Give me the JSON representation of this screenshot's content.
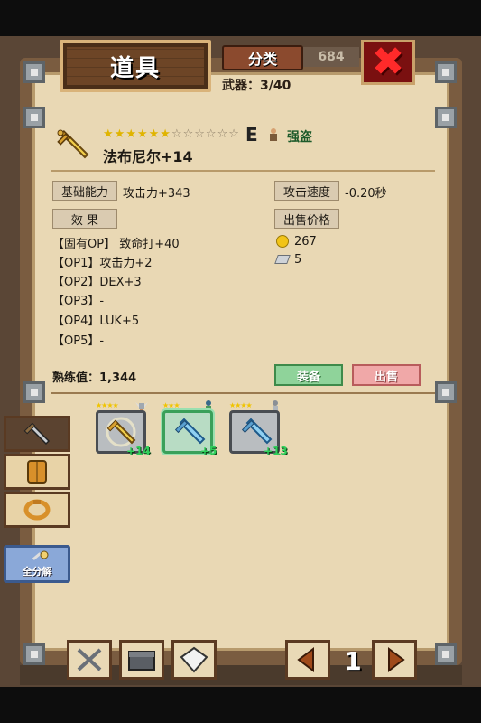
{
  "header": {
    "title": "道具",
    "category_label": "分类",
    "weapon_count": "武器：3/40",
    "close_icon": "close-x-icon",
    "obscured_counter": "684"
  },
  "item": {
    "icon": "golden-sword-icon",
    "stars_filled": 6,
    "stars_total": 12,
    "grade": "E",
    "class_icon": "thief-icon",
    "class_name": "强盗",
    "name": "法布尼尔+14",
    "base_ability_label": "基础能力",
    "base_ability_value": "攻击力+343",
    "attack_speed_label": "攻击速度",
    "attack_speed_value": "-0.20秒",
    "effects_label": "效 果",
    "sell_price_label": "出售价格",
    "effects": [
      "【固有OP】 致命打+40",
      "【OP1】攻击力+2",
      "【OP2】DEX+3",
      "【OP3】-",
      "【OP4】LUK+5",
      "【OP5】-"
    ],
    "gold_price": "267",
    "crystal_price": "5",
    "proficiency": "熟练值：1,344",
    "equip_label": "装备",
    "sell_label": "出售"
  },
  "inventory": [
    {
      "icon": "golden-sword-icon",
      "level": "+14",
      "stars": "★★★★",
      "char_icon": "winged-helmet-icon",
      "selected": false
    },
    {
      "icon": "ice-sword-icon",
      "level": "+5",
      "stars": "★★★",
      "char_icon": "hero-icon",
      "selected": true
    },
    {
      "icon": "ice-sword-icon",
      "level": "+13",
      "stars": "★★★★",
      "char_icon": "knight-icon",
      "selected": false
    }
  ],
  "side_tabs": [
    {
      "icon": "sword-icon",
      "active": true
    },
    {
      "icon": "armor-icon",
      "active": false
    },
    {
      "icon": "ring-icon",
      "active": false
    }
  ],
  "disassemble_label": "全分解",
  "bottom_bar": {
    "buttons": [
      "crossed-swords-icon",
      "chest-icon",
      "gem-icon"
    ],
    "page_number": "1"
  },
  "colors": {
    "panel": "#e9d8b4",
    "frame": "#7a5c40",
    "equip_green": "#8fd39a",
    "sell_pink": "#f0a8a8",
    "class_green": "#1c5a2a",
    "plus_green": "#2fd05a"
  }
}
